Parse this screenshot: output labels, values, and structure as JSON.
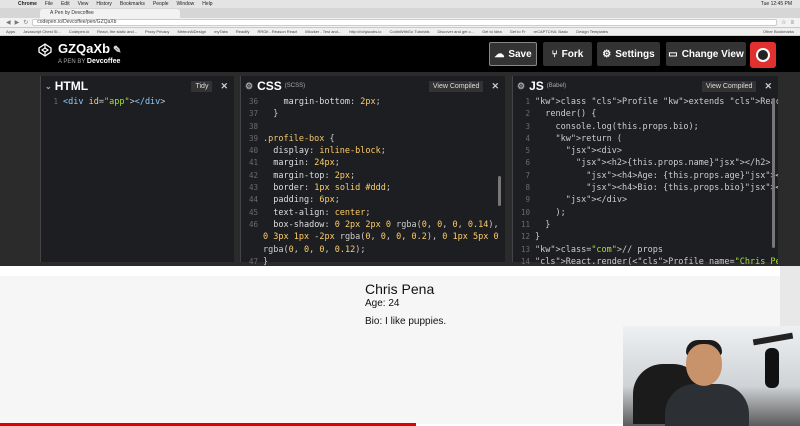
{
  "mac_menu": {
    "app": "Chrome",
    "items": [
      "File",
      "Edit",
      "View",
      "History",
      "Bookmarks",
      "People",
      "Window",
      "Help"
    ],
    "clock": "Tue 12:45 PM"
  },
  "browser": {
    "tab_title": "A Pen by Devcoffee",
    "url": "codepen.io/Devcoffee/pen/GZQaXb",
    "bookmarks": [
      "Apps",
      "Javascript Chest Sl...",
      "Codepen.io",
      "React, the static and...",
      "Proxy Privacy",
      "MeteorAtDesign",
      "myTabs",
      "Readify",
      "RRGit - Reason React",
      "Mlocker - Test and...",
      "http://richjacobs.io",
      "CodinWithGo Tutorials",
      "Discover and get c...",
      "Get to Idea",
      "Get to Fr",
      "reCAPTCHA: Basic",
      "Design Templates"
    ],
    "other_bookmarks": "Other Bookmarks"
  },
  "header": {
    "pen_name": "GZQaXb",
    "byline_prefix": "A PEN BY",
    "author": "Devcoffee",
    "save": "Save",
    "fork": "Fork",
    "settings": "Settings",
    "change_view": "Change View"
  },
  "panes": {
    "html": {
      "title": "HTML",
      "action": "Tidy"
    },
    "css": {
      "title": "CSS",
      "preprocessor": "(SCSS)",
      "action": "View Compiled"
    },
    "js": {
      "title": "JS",
      "preprocessor": "(Babel)",
      "action": "View Compiled"
    }
  },
  "html_code": [
    {
      "n": "1",
      "code": "<div id=\"app\"></div>"
    }
  ],
  "css_code": [
    {
      "n": "36",
      "code": "    margin-bottom: 2px;"
    },
    {
      "n": "37",
      "code": "  }"
    },
    {
      "n": "38",
      "code": ""
    },
    {
      "n": "39",
      "code": ".profile-box {"
    },
    {
      "n": "40",
      "code": "  display: inline-block;"
    },
    {
      "n": "41",
      "code": "  margin: 24px;"
    },
    {
      "n": "42",
      "code": "  margin-top: 2px;"
    },
    {
      "n": "43",
      "code": "  border: 1px solid #ddd;"
    },
    {
      "n": "44",
      "code": "  padding: 6px;"
    },
    {
      "n": "45",
      "code": "  text-align: center;"
    },
    {
      "n": "46",
      "code": "  box-shadow: 0 2px 2px 0 rgba(0, 0, 0, 0.14),"
    },
    {
      "n": "",
      "code": "0 3px 1px -2px rgba(0, 0, 0, 0.2), 0 1px 5px 0"
    },
    {
      "n": "",
      "code": "rgba(0, 0, 0, 0.12);"
    },
    {
      "n": "47",
      "code": "}"
    },
    {
      "n": "48",
      "code": ""
    }
  ],
  "js_code": [
    {
      "n": "1",
      "code": "class Profile extends React.Component {"
    },
    {
      "n": "2",
      "code": "  render() {"
    },
    {
      "n": "3",
      "code": "    console.log(this.props.bio);"
    },
    {
      "n": "4",
      "code": "    return ("
    },
    {
      "n": "5",
      "code": "      <div>"
    },
    {
      "n": "6",
      "code": "        <h2>{this.props.name}</h2>"
    },
    {
      "n": "7",
      "code": "          <h4>Age: {this.props.age}</h4>"
    },
    {
      "n": "8",
      "code": "          <h4>Bio: {this.props.bio}</h4>"
    },
    {
      "n": "9",
      "code": "      </div>"
    },
    {
      "n": "10",
      "code": "    );"
    },
    {
      "n": "11",
      "code": "  }"
    },
    {
      "n": "12",
      "code": "}"
    },
    {
      "n": "13",
      "code": "// props"
    },
    {
      "n": "14",
      "code": "React.render(<Profile name=\"Chris Pena\" age="
    }
  ],
  "preview": {
    "name": "Chris Pena",
    "age": "Age: 24",
    "bio": "Bio: I like puppies."
  },
  "video_progress": 0.52,
  "colors": {
    "header_bg": "#000000",
    "editor_bg": "#1d1e22",
    "accent_red": "#e03030",
    "progress_red": "#e00000"
  }
}
